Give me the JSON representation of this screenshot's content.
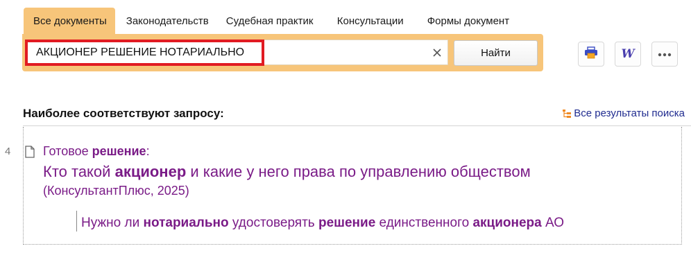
{
  "tabs": [
    {
      "label": "Все документы",
      "active": true
    },
    {
      "label": "Законодательств"
    },
    {
      "label": "Судебная практик"
    },
    {
      "label": "Консультации"
    },
    {
      "label": "Формы документ"
    }
  ],
  "search": {
    "query": "АКЦИОНЕР РЕШЕНИЕ НОТАРИАЛЬНО",
    "clear_icon": "close-icon",
    "button_label": "Найти"
  },
  "tools": {
    "print_icon": "printer-icon",
    "word_icon": "word-export-icon",
    "word_glyph": "W",
    "more_icon": "more-dots-icon",
    "more_glyph": "•••"
  },
  "results": {
    "header": "Наиболее соответствуют запросу:",
    "all_results_label": "Все результаты поиска",
    "item": {
      "number": "4",
      "type_prefix": "Готовое ",
      "type_keyword": "решение",
      "type_suffix": ":",
      "title_part1": "Кто такой ",
      "title_keyword": "акционер",
      "title_part2": " и какие у него права по управлению обществом",
      "source": "(КонсультантПлюс, 2025)",
      "snippet_part1": "Нужно ли ",
      "snippet_kw1": "нотариально",
      "snippet_part2": " удостоверять ",
      "snippet_kw2": "решение",
      "snippet_part3": " единственного ",
      "snippet_kw3": "акционера",
      "snippet_part4": " АО"
    }
  },
  "colors": {
    "accent": "#f7c57a",
    "highlight_border": "#e11b22",
    "result_text": "#7a1b87",
    "link": "#1f2b8f",
    "print_icon": "#3a4cc4",
    "word_icon": "#4a3fae"
  }
}
